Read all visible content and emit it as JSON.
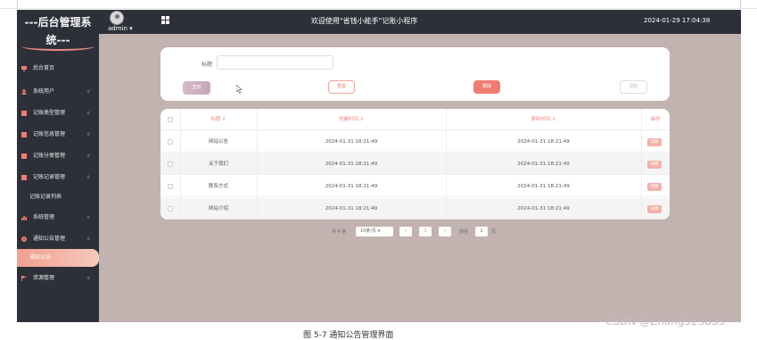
{
  "brand": {
    "title": "---后台管理系统---"
  },
  "header": {
    "user": "admin ▾",
    "title": "欢迎使用\"省钱小能手\"记账小程序",
    "datetime": "2024-01-29 17:04:38"
  },
  "sidebar": {
    "items": [
      {
        "label": "后台首页",
        "icon": "monitor-icon",
        "arrow": ""
      },
      {
        "label": "系统用户",
        "icon": "user-icon",
        "arrow": "∨"
      },
      {
        "label": "记账类型管理",
        "icon": "square-icon",
        "arrow": "∨"
      },
      {
        "label": "记账信息管理",
        "icon": "square-icon",
        "arrow": "∨"
      },
      {
        "label": "记账分类管理",
        "icon": "square-icon",
        "arrow": "∨"
      },
      {
        "label": "记账记录管理",
        "icon": "square-icon",
        "arrow": "∧"
      },
      {
        "label": "记账记录列表",
        "sub": true
      },
      {
        "label": "系统管理",
        "icon": "chart-icon",
        "arrow": "∨"
      },
      {
        "label": "通知公告管理",
        "icon": "info-icon",
        "arrow": "∧"
      },
      {
        "label": "通知公告",
        "active": true
      },
      {
        "label": "资源管理",
        "icon": "flag-icon",
        "arrow": "∨"
      }
    ],
    "accent": "#f29f8e"
  },
  "search": {
    "label": "标题",
    "placeholder": "",
    "buttons": {
      "search": "查询",
      "reset": "重置",
      "delete": "删除",
      "add": "添加"
    }
  },
  "table": {
    "headers": [
      "标题 ⇕",
      "创建时间 ⇕",
      "更新时间 ⇕",
      "操作"
    ],
    "rows": [
      {
        "title": "网站公告",
        "created": "2024-01-31 18:21:49",
        "updated": "2024-01-31 18:21:49",
        "action": "详情"
      },
      {
        "title": "关于我们",
        "created": "2024-01-31 18:21:49",
        "updated": "2024-01-31 18:21:49",
        "action": "详情"
      },
      {
        "title": "联系方式",
        "created": "2024-01-31 18:21:49",
        "updated": "2024-01-31 18:21:49",
        "action": "详情"
      },
      {
        "title": "网站介绍",
        "created": "2024-01-31 18:21:49",
        "updated": "2024-01-31 18:21:49",
        "action": "详情"
      }
    ]
  },
  "pager": {
    "total": "共 4 条",
    "size": "10条/页 ▾",
    "prev": "‹",
    "page": "1",
    "next": "›",
    "goto_label": "前往",
    "goto_value": "1",
    "unit": "页"
  },
  "caption": "图 5-7 通知公告管理界面",
  "watermark": "CSDN @Zhang523853",
  "colors": {
    "sidebar": "#2d3039",
    "content_bg": "#c2b2b0",
    "accent": "#f08a80",
    "delete": "#f07c72"
  }
}
